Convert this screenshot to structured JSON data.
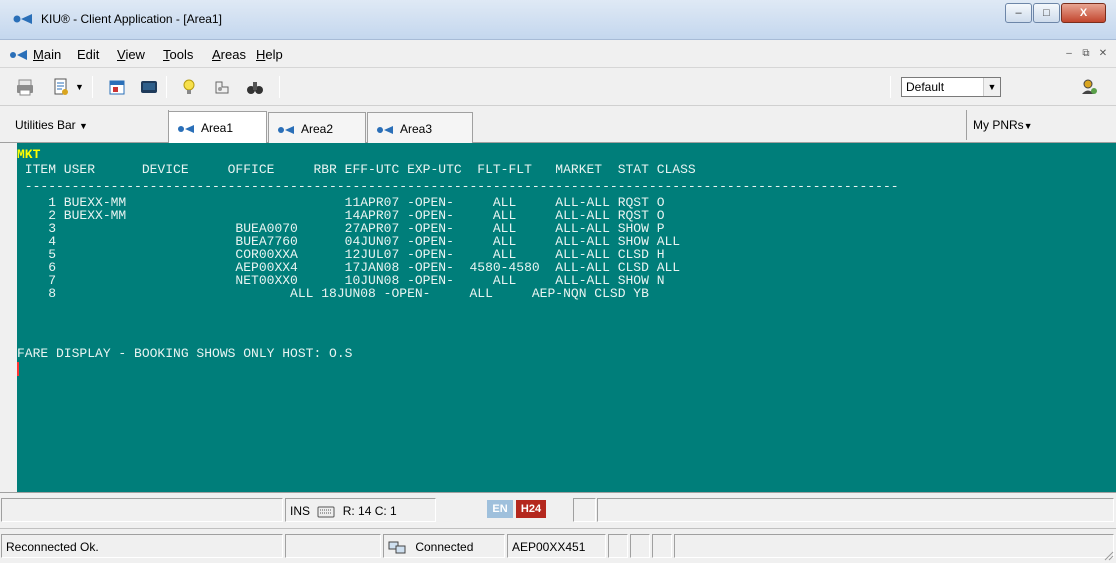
{
  "window": {
    "title": "KIU® - Client Application - [Area1]"
  },
  "menu": {
    "items": [
      {
        "label": "Main",
        "accel": "M",
        "rest": "ain"
      },
      {
        "label": "Edit",
        "accel": "",
        "rest": "Edit"
      },
      {
        "label": "View",
        "accel": "V",
        "rest": "iew"
      },
      {
        "label": "Tools",
        "accel": "T",
        "rest": "ools"
      },
      {
        "label": "Areas",
        "accel": "A",
        "rest": "reas"
      },
      {
        "label": "Help",
        "accel": "H",
        "rest": "elp"
      }
    ]
  },
  "toolbar": {
    "profile_select": {
      "value": "Default"
    },
    "icons": [
      "printer-icon",
      "document-icon",
      "calendar-icon",
      "terminal-icon",
      "lightbulb-icon",
      "puzzle-icon",
      "binoculars-icon"
    ]
  },
  "tabs": {
    "utilities_label": "Utilities Bar",
    "my_pnrs_label": "My PNRs",
    "areas": [
      "Area1",
      "Area2",
      "Area3"
    ],
    "active": "Area1"
  },
  "terminal": {
    "header_label": "MKT",
    "lines": [
      " ITEM USER      DEVICE     OFFICE     RBR EFF-UTC EXP-UTC  FLT-FLT   MARKET  STAT CLASS",
      " ----------------------------------------------------------------------------------------------------------------",
      "    1 BUEXX-MM                            11APR07 -OPEN-     ALL     ALL-ALL RQST O",
      "    2 BUEXX-MM                            14APR07 -OPEN-     ALL     ALL-ALL RQST O",
      "    3                       BUEA0070      27APR07 -OPEN-     ALL     ALL-ALL SHOW P",
      "    4                       BUEA7760      04JUN07 -OPEN-     ALL     ALL-ALL SHOW ALL",
      "    5                       COR00XXA      12JUL07 -OPEN-     ALL     ALL-ALL CLSD H",
      "    6                       AEP00XX4      17JAN08 -OPEN-  4580-4580  ALL-ALL CLSD ALL",
      "    7                       NET00XX0      10JUN08 -OPEN-     ALL     ALL-ALL SHOW N",
      "    8                              ALL 18JUN08 -OPEN-     ALL     AEP-NQN CLSD YB",
      "",
      "FARE DISPLAY - BOOKING SHOWS ONLY HOST: O.S"
    ],
    "colors": {
      "background": "#007e7a",
      "text": "#e8f4f2",
      "header": "#ffff00"
    }
  },
  "status": {
    "ins": "INS",
    "position": "R: 14 C: 1",
    "lang_badge": "EN",
    "mode_badge": "H24",
    "message": "Reconnected Ok.",
    "connection": "Connected",
    "office_id": "AEP00XX451"
  }
}
